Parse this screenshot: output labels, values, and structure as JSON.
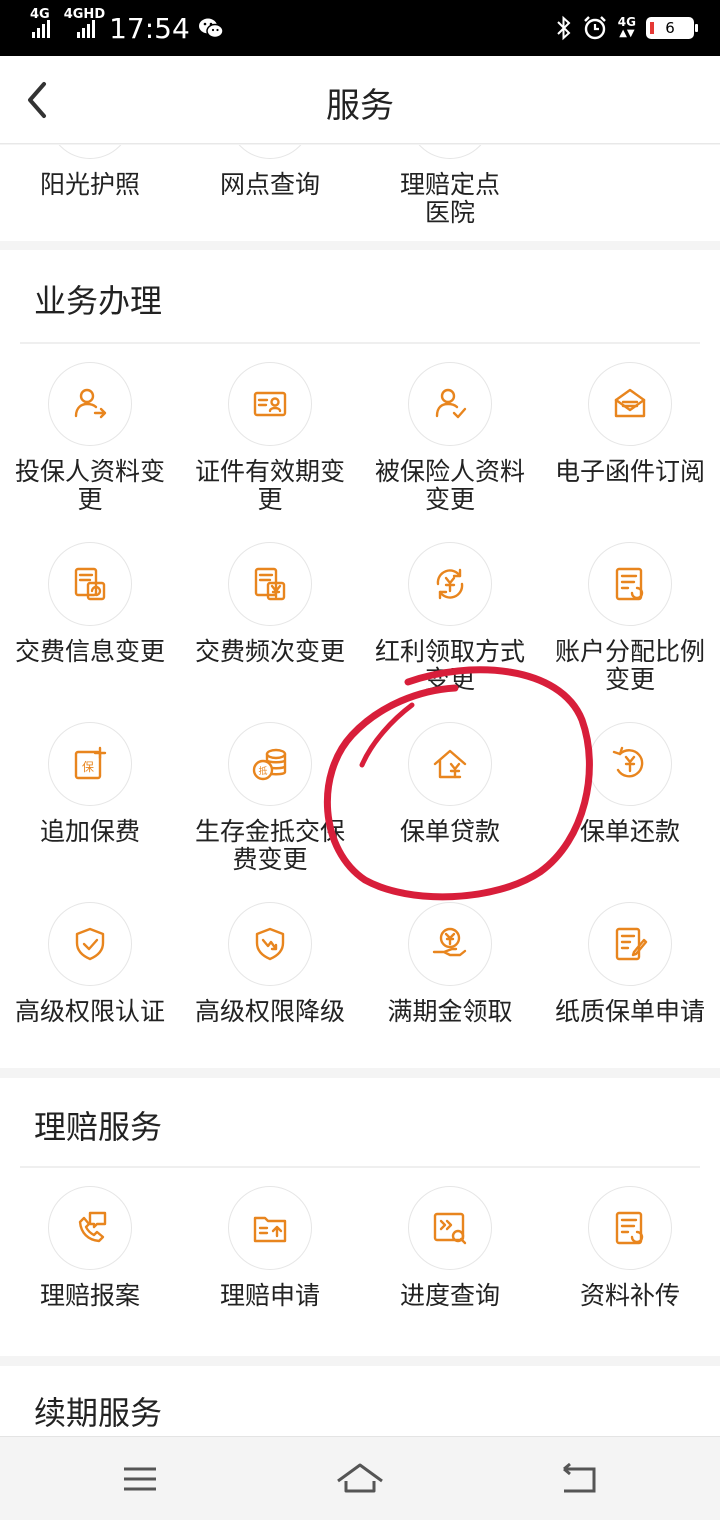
{
  "status_bar": {
    "net1": "4G",
    "net2": "4GHD",
    "time": "17:54",
    "net3": "4G",
    "battery": "6"
  },
  "header": {
    "title": "服务"
  },
  "top_row": [
    "阳光护照",
    "网点查询",
    "理赔定点医院"
  ],
  "sections": [
    {
      "title": "业务办理",
      "items": [
        {
          "label": "投保人资料变更",
          "icon": "person-arrow-icon"
        },
        {
          "label": "证件有效期变更",
          "icon": "id-card-icon"
        },
        {
          "label": "被保险人资料变更",
          "icon": "person-check-icon"
        },
        {
          "label": "电子函件订阅",
          "icon": "envelope-icon"
        },
        {
          "label": "交费信息变更",
          "icon": "document-refresh-icon"
        },
        {
          "label": "交费频次变更",
          "icon": "document-yen-icon"
        },
        {
          "label": "红利领取方式变更",
          "icon": "yen-cycle-icon"
        },
        {
          "label": "账户分配比例变更",
          "icon": "form-refresh-icon"
        },
        {
          "label": "追加保费",
          "icon": "bao-plus-icon"
        },
        {
          "label": "生存金抵交保费变更",
          "icon": "coins-icon"
        },
        {
          "label": "保单贷款",
          "icon": "house-yen-icon"
        },
        {
          "label": "保单还款",
          "icon": "yen-return-icon"
        },
        {
          "label": "高级权限认证",
          "icon": "shield-check-icon"
        },
        {
          "label": "高级权限降级",
          "icon": "shield-down-icon"
        },
        {
          "label": "满期金领取",
          "icon": "hand-yen-icon"
        },
        {
          "label": "纸质保单申请",
          "icon": "document-pen-icon"
        }
      ]
    },
    {
      "title": "理赔服务",
      "items": [
        {
          "label": "理赔报案",
          "icon": "phone-call-icon"
        },
        {
          "label": "理赔申请",
          "icon": "folder-upload-icon"
        },
        {
          "label": "进度查询",
          "icon": "progress-search-icon"
        },
        {
          "label": "资料补传",
          "icon": "form-refresh-icon"
        }
      ]
    },
    {
      "title": "续期服务",
      "items": []
    }
  ],
  "colors": {
    "accent": "#e8851e",
    "annotation": "#d81e3a"
  }
}
